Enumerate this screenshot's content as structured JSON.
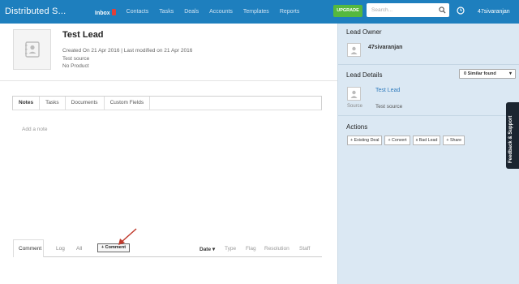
{
  "header": {
    "brand": "Distributed S...",
    "nav": [
      {
        "label": "Inbox",
        "active": true
      },
      {
        "label": "Contacts"
      },
      {
        "label": "Tasks"
      },
      {
        "label": "Deals"
      },
      {
        "label": "Accounts"
      },
      {
        "label": "Templates"
      },
      {
        "label": "Reports"
      }
    ],
    "upgrade_label": "UPGRADE",
    "search_placeholder": "Search...",
    "user_name": "47sivaranjan",
    "icons": {
      "search": "search-icon",
      "clock": "clock-icon",
      "badge_color": "#e0403a"
    }
  },
  "lead": {
    "name": "Test Lead",
    "meta_line1": "Created On 21 Apr 2016  |  Last modified on 21 Apr 2016",
    "source": "Test source",
    "product": "No Product"
  },
  "tabs": [
    "Notes",
    "Tasks",
    "Documents",
    "Custom Fields"
  ],
  "notes": {
    "placeholder": "Add a note"
  },
  "activity": {
    "tabs": [
      "Comment",
      "Log",
      "All"
    ],
    "comment_button": "+ Comment",
    "columns": [
      "Date",
      "Type",
      "Flag",
      "Resolution",
      "Staff"
    ]
  },
  "sidebar": {
    "owner_heading": "Lead Owner",
    "owner_name": "47sivaranjan",
    "details_heading": "Lead Details",
    "similar_label": "0 Similar found",
    "lead_link": "Test Lead",
    "source_label": "Source",
    "source_value": "Test source",
    "actions_heading": "Actions",
    "actions": [
      "+ Existing Deal",
      "+ Convert",
      "x Bad Lead",
      "+ Share"
    ]
  },
  "feedback_label": "Feedback & Support",
  "colors": {
    "topbar": "#1e7fbe",
    "upgrade": "#55b83e",
    "sidebar": "#dbe8f3",
    "link": "#2f7bbd",
    "arrow": "#c0392b"
  }
}
